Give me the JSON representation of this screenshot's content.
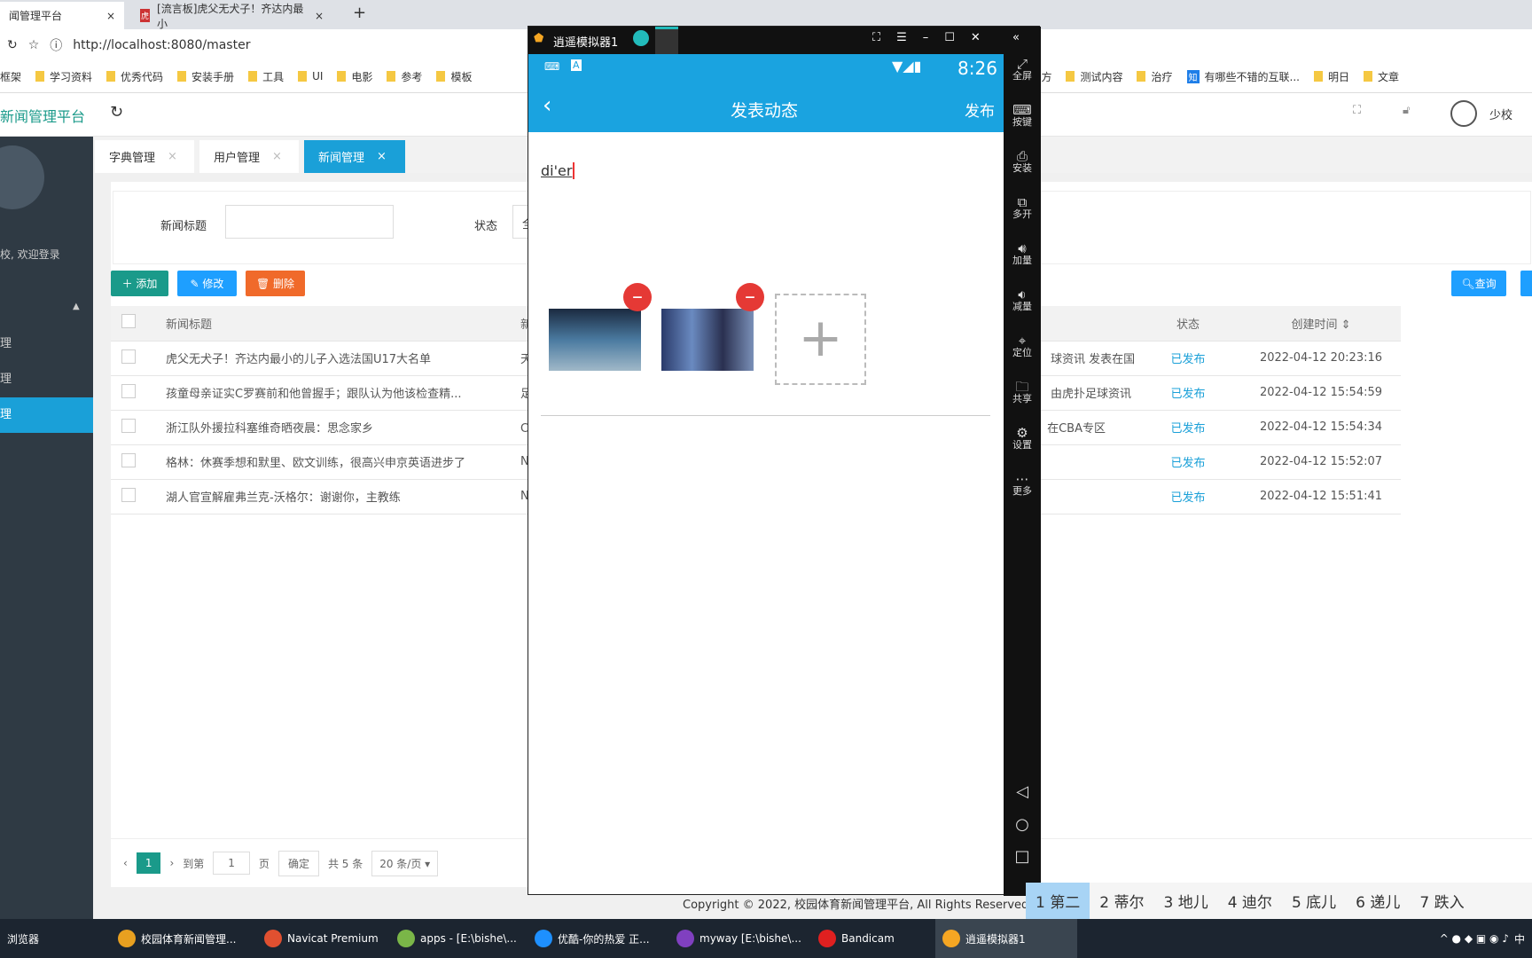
{
  "browser": {
    "tabs": [
      {
        "label": "闻管理平台",
        "active": true
      },
      {
        "label": "[流言板]虎父无犬子！齐达内最小",
        "active": false
      }
    ],
    "url": "http://localhost:8080/master",
    "bookmarks": [
      "框架",
      "学习资料",
      "优秀代码",
      "安装手册",
      "工具",
      "UI",
      "电影",
      "参考",
      "模板",
      "公司官方",
      "测试内容",
      "治疗",
      "有哪些不错的互联...",
      "明日",
      "文章"
    ]
  },
  "app": {
    "title": "新闻管理平台",
    "user": "少校",
    "welcome": "校, 欢迎登录",
    "sidebar": [
      "理",
      "理",
      "理"
    ],
    "tabs": [
      {
        "label": "字典管理"
      },
      {
        "label": "用户管理"
      },
      {
        "label": "新闻管理",
        "active": true
      }
    ],
    "search": {
      "title_label": "新闻标题",
      "status_label": "状态",
      "status_value": "全",
      "query": "查询"
    },
    "actions": {
      "add": "添加",
      "edit": "修改",
      "delete": "删除"
    },
    "table": {
      "headers": [
        "新闻标题",
        "新",
        "状态",
        "创建时间"
      ],
      "rows": [
        {
          "title": "虎父无犬子！齐达内最小的儿子入选法国U17大名单",
          "c2": "天",
          "c3": "球资讯 发表在国际",
          "status": "已发布",
          "time": "2022-04-12 20:23:16"
        },
        {
          "title": "孩童母亲证实C罗赛前和他曾握手；跟队认为他该检查精...",
          "c2": "足",
          "c3": "由虎扑足球资讯",
          "status": "已发布",
          "time": "2022-04-12 15:54:59"
        },
        {
          "title": "浙江队外援拉科塞维奇晒夜晨：思念家乡",
          "c2": "C",
          "c3": "在CBA专区",
          "status": "已发布",
          "time": "2022-04-12 15:54:34"
        },
        {
          "title": "格林：休赛季想和默里、欧文训练，很高兴申京英语进步了",
          "c2": "N",
          "c3": "",
          "status": "已发布",
          "time": "2022-04-12 15:52:07"
        },
        {
          "title": "湖人官宣解雇弗兰克-沃格尔：谢谢你，主教练",
          "c2": "N",
          "c3": "",
          "status": "已发布",
          "time": "2022-04-12 15:51:41"
        }
      ]
    },
    "pagination": {
      "page": "1",
      "goto": "到第",
      "page_input": "1",
      "page_unit": "页",
      "confirm": "确定",
      "total": "共 5 条",
      "per_page": "20 条/页"
    },
    "copyright": "Copyright © 2022, 校园体育新闻管理平台, All Rights Reserved"
  },
  "emulator": {
    "title": "逍遥模拟器1",
    "time": "8:26",
    "page_title": "发表动态",
    "publish": "发布",
    "input_text": "di'er",
    "toolbar": [
      "全屏",
      "按键",
      "安装",
      "多开",
      "加量",
      "减量",
      "定位",
      "共享",
      "设置",
      "更多"
    ]
  },
  "ime": {
    "candidates": [
      "1 第二",
      "2 蒂尔",
      "3 地儿",
      "4 迪尔",
      "5 底儿",
      "6 递儿",
      "7 跌入"
    ]
  },
  "taskbar": {
    "items": [
      "浏览器",
      "校园体育新闻管理...",
      "Navicat Premium",
      "apps - [E:\\bishe\\...",
      "优酷-你的热爱 正...",
      "myway [E:\\bishe\\...",
      "Bandicam",
      "逍遥模拟器1"
    ],
    "ime_lang": "中"
  },
  "colors": {
    "accent": "#1aa0d8",
    "add": "#1a9a8a",
    "edit": "#1e9fff",
    "delete": "#f06a2a",
    "status": "#1aa0d8"
  }
}
